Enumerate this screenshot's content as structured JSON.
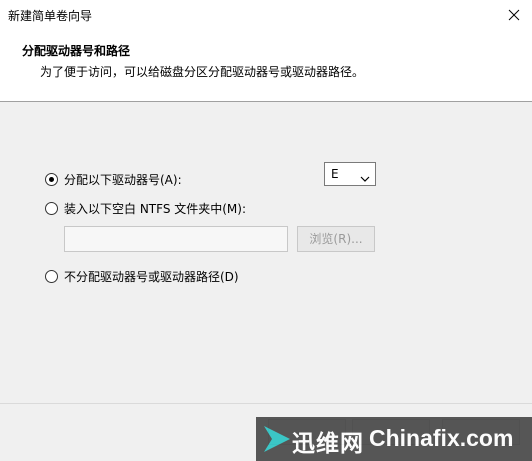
{
  "window": {
    "title": "新建简单卷向导"
  },
  "header": {
    "title": "分配驱动器号和路径",
    "subtitle": "为了便于访问，可以给磁盘分区分配驱动器号或驱动器路径。"
  },
  "options": {
    "assign_letter": {
      "label": "分配以下驱动器号(A):",
      "selected": true
    },
    "mount_folder": {
      "label": "装入以下空白 NTFS 文件夹中(M):",
      "selected": false
    },
    "no_assign": {
      "label": "不分配驱动器号或驱动器路径(D)",
      "selected": false
    }
  },
  "drive_letter": {
    "value": "E"
  },
  "folder_path": {
    "value": ""
  },
  "browse_button": {
    "label": "浏览(R)..."
  },
  "watermark": {
    "cn_text": "迅维网",
    "en_text": "Chinafix.com",
    "accent_color": "#2ec4c4"
  }
}
